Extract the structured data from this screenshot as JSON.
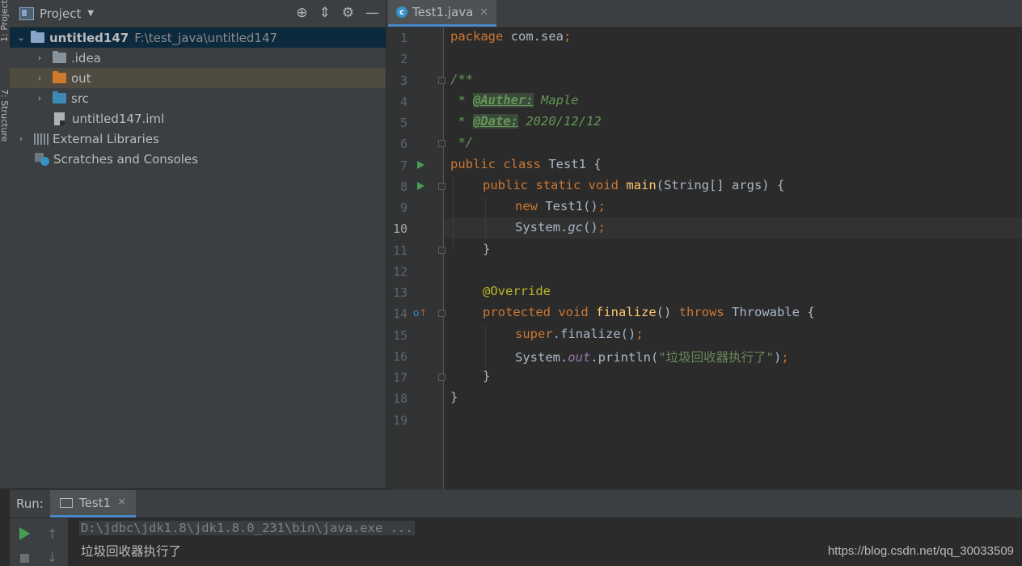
{
  "sidebar": {
    "vertical_tab_1": "1: Project",
    "vertical_tab_2": "7: Structure"
  },
  "project_panel": {
    "title": "Project",
    "tree": [
      {
        "label": "untitled147",
        "path": "F:\\test_java\\untitled147",
        "icon": "module-folder-icon",
        "expanded": true,
        "selected": true
      },
      {
        "label": ".idea",
        "icon": "folder-icon",
        "expanded": false
      },
      {
        "label": "out",
        "icon": "excluded-folder-icon",
        "expanded": false,
        "highlighted": true
      },
      {
        "label": "src",
        "icon": "source-folder-icon",
        "expanded": false
      },
      {
        "label": "untitled147.iml",
        "icon": "file-icon"
      },
      {
        "label": "External Libraries",
        "icon": "library-icon",
        "expanded": false
      },
      {
        "label": "Scratches and Consoles",
        "icon": "scratches-icon"
      }
    ]
  },
  "editor": {
    "tab_label": "Test1.java",
    "current_line": "10",
    "line_numbers": [
      "1",
      "2",
      "3",
      "4",
      "5",
      "6",
      "7",
      "8",
      "9",
      "10",
      "11",
      "12",
      "13",
      "14",
      "15",
      "16",
      "17",
      "18",
      "19"
    ],
    "code": {
      "l1_kw": "package",
      "l1_rest": " com.sea",
      "l1_semi": ";",
      "l3": "/**",
      "l4_star": " * ",
      "l4_tag": "@Auther:",
      "l4_val": " Maple",
      "l5_star": " * ",
      "l5_tag": "@Date:",
      "l5_val": " 2020/12/12",
      "l6": " */",
      "l7_kw": "public class",
      "l7_rest": " Test1 {",
      "l8_kw": "public static void",
      "l8_fn": "main",
      "l8_rest": "(String[] args) {",
      "l9_kw": "new",
      "l9_rest": " Test1()",
      "l9_semi": ";",
      "l10_a": "System.",
      "l10_it": "gc",
      "l10_b": "()",
      "l10_semi": ";",
      "l11": "}",
      "l13": "@Override",
      "l14_kw": "protected void",
      "l14_fn": "finalize",
      "l14_mid": "()",
      "l14_kw2": "throws",
      "l14_rest": " Throwable {",
      "l15_kw": "super",
      "l15_rest": ".finalize()",
      "l15_semi": ";",
      "l16_a": "System.",
      "l16_fld": "out",
      "l16_b": ".println(",
      "l16_str": "\"垃圾回收器执行了\"",
      "l16_c": ")",
      "l16_semi": ";",
      "l17": "}",
      "l18": "}"
    }
  },
  "run_panel": {
    "label": "Run:",
    "tab_label": "Test1",
    "output_line_1": "D:\\jdbc\\jdk1.8\\jdk1.8.0_231\\bin\\java.exe ...",
    "output_line_2": "垃圾回收器执行了"
  },
  "watermark": "https://blog.csdn.net/qq_30033509",
  "colors": {
    "keyword": "#cc7832",
    "string": "#6a8759",
    "annotation": "#bbb529",
    "function": "#ffc66d",
    "comment": "#629755",
    "accent": "#4a88c7"
  }
}
